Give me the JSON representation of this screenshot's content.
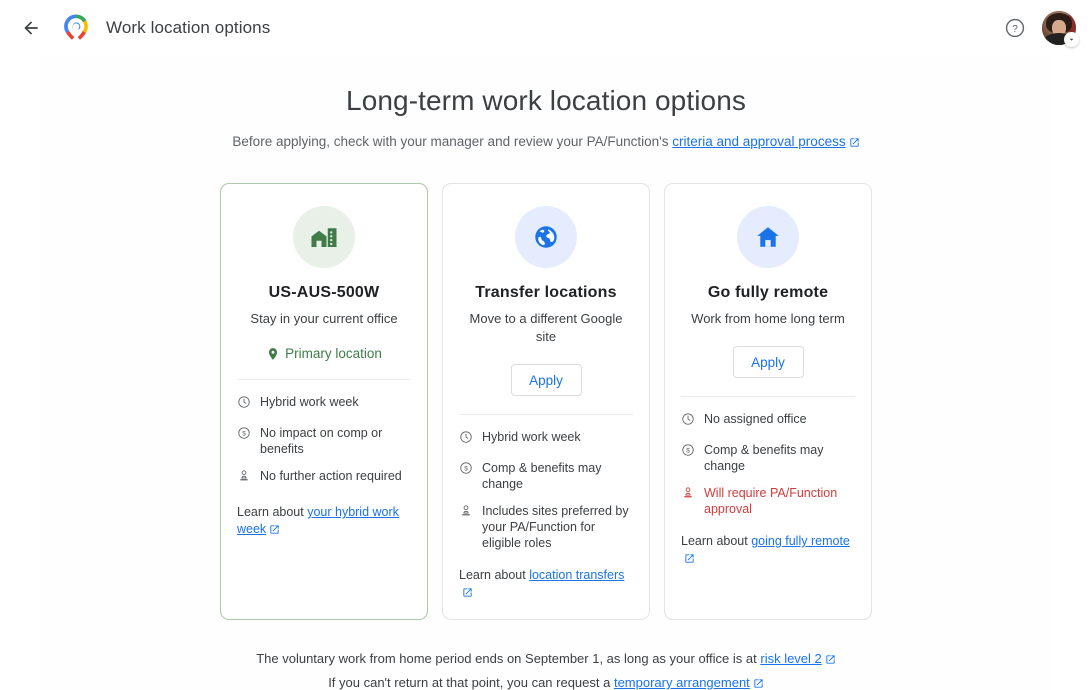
{
  "header": {
    "back_icon": "back-arrow-icon",
    "logo_icon": "google-work-location-logo",
    "title": "Work location options",
    "help_icon": "help-circle-icon",
    "avatar_icon": "user-avatar",
    "caret_icon": "chevron-down-icon"
  },
  "hero": {
    "title": "Long-term work location options",
    "subtitle_before": "Before applying, check with your manager and review your PA/Function's ",
    "subtitle_link": "criteria and approval process",
    "external_icon": "external-link-icon"
  },
  "cards": [
    {
      "id": "current-office",
      "icon": "office-building-icon",
      "icon_style": "green",
      "title": "US-AUS-500W",
      "subtitle": "Stay in your current office",
      "badge": {
        "icon": "location-pin-icon",
        "label": "Primary location"
      },
      "action": null,
      "features": [
        {
          "icon": "clock-icon",
          "text": "Hybrid work week",
          "warn": false
        },
        {
          "icon": "dollar-icon",
          "text": "No impact on comp or benefits",
          "warn": false
        },
        {
          "icon": "stamp-icon",
          "text": "No further action required",
          "warn": false
        }
      ],
      "learn_prefix": "Learn about ",
      "learn_link": "your hybrid work week"
    },
    {
      "id": "transfer-locations",
      "icon": "globe-icon",
      "icon_style": "blue",
      "title": "Transfer locations",
      "subtitle": "Move to a different Google site",
      "badge": null,
      "action": "Apply",
      "features": [
        {
          "icon": "clock-icon",
          "text": "Hybrid work week",
          "warn": false
        },
        {
          "icon": "dollar-icon",
          "text": "Comp & benefits may change",
          "warn": false
        },
        {
          "icon": "stamp-icon",
          "text": "Includes sites preferred by your PA/Function for eligible roles",
          "warn": false
        }
      ],
      "learn_prefix": "Learn about ",
      "learn_link": "location transfers"
    },
    {
      "id": "go-fully-remote",
      "icon": "home-icon",
      "icon_style": "blue",
      "title": "Go fully remote",
      "subtitle": "Work from home long term",
      "badge": null,
      "action": "Apply",
      "features": [
        {
          "icon": "clock-icon",
          "text": "No assigned office",
          "warn": false
        },
        {
          "icon": "dollar-icon",
          "text": "Comp & benefits may change",
          "warn": false
        },
        {
          "icon": "stamp-icon",
          "text": "Will require PA/Function approval",
          "warn": true
        }
      ],
      "learn_prefix": "Learn about ",
      "learn_link": "going fully remote"
    }
  ],
  "footer": {
    "line1_before": "The voluntary work from home period ends on September 1, as long as your office is at ",
    "line1_link": "risk level 2",
    "line2_before": "If you can't return at that point, you can request a ",
    "line2_link": "temporary arrangement"
  },
  "colors": {
    "link": "#1a73e8",
    "primary_green": "#3f7c47",
    "warn_red": "#d03c3c",
    "text": "#3c4043"
  }
}
